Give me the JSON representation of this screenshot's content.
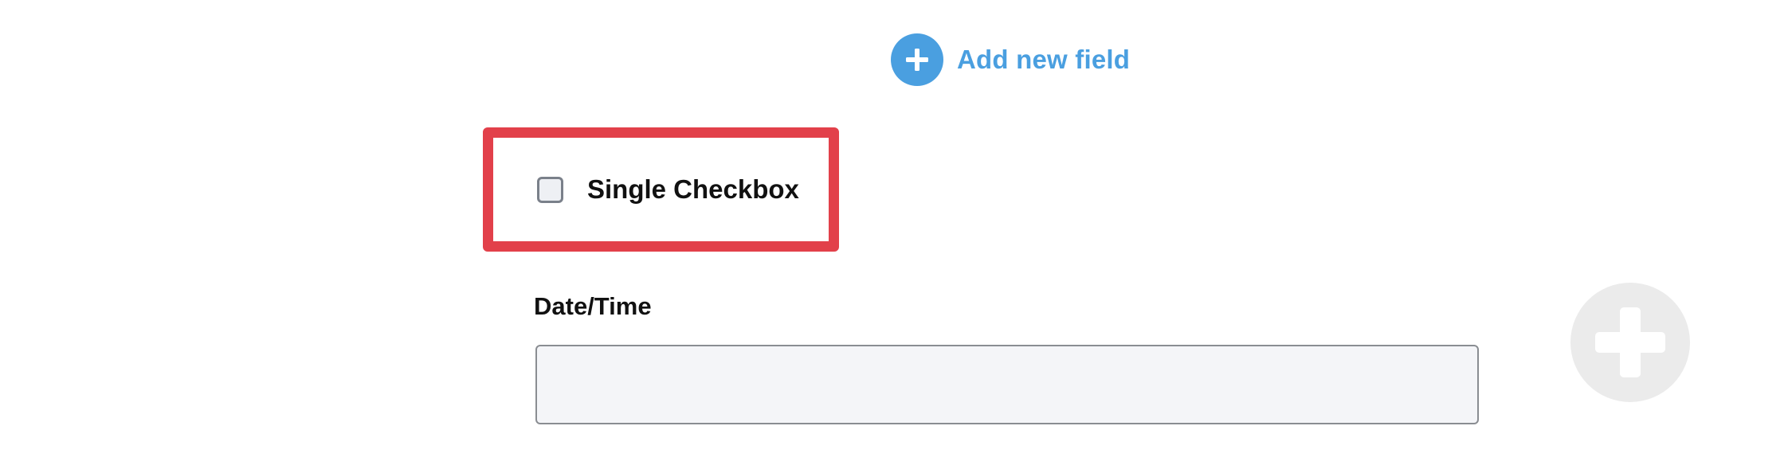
{
  "add_field": {
    "label": "Add new field",
    "icon": "plus-circle-icon",
    "color": "#4a9fe0"
  },
  "checkbox_field": {
    "label": "Single Checkbox",
    "checked": false,
    "highlight_color": "#e2404a"
  },
  "datetime_field": {
    "label": "Date/Time",
    "value": "",
    "placeholder": ""
  },
  "floating_add": {
    "icon": "plus-icon",
    "color": "#ebebeb"
  }
}
